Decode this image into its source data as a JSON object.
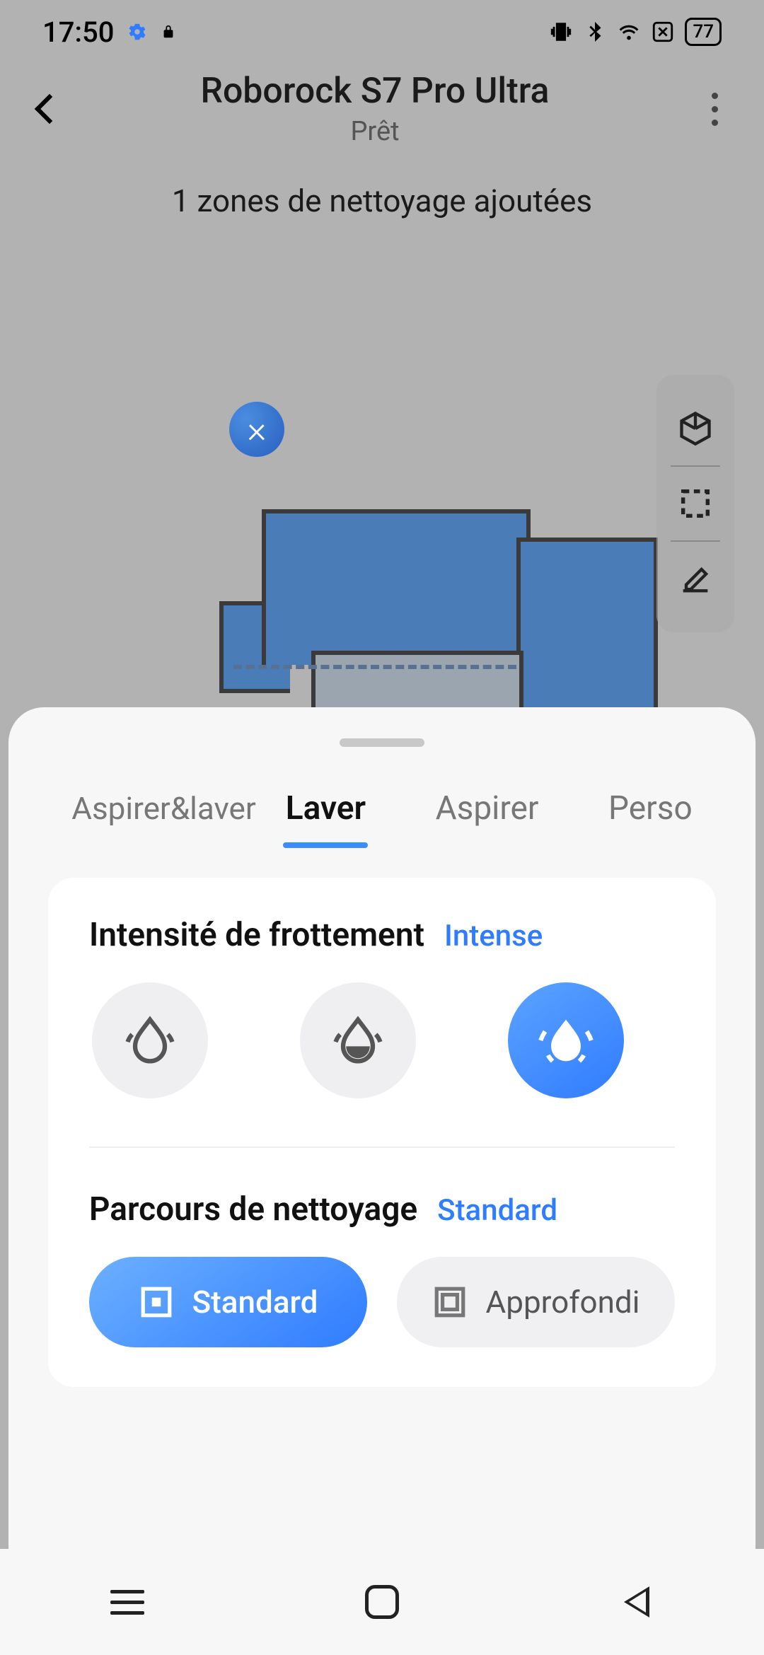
{
  "statusbar": {
    "time": "17:50",
    "battery": "77"
  },
  "header": {
    "title": "Roborock S7 Pro Ultra",
    "status": "Prêt"
  },
  "zones_message": "1 zones de nettoyage ajoutées",
  "sheet": {
    "tabs": [
      {
        "label": "Aspirer&laver",
        "active": false
      },
      {
        "label": "Laver",
        "active": true
      },
      {
        "label": "Aspirer",
        "active": false
      },
      {
        "label": "Perso",
        "active": false
      }
    ],
    "intensity": {
      "title": "Intensité de frottement",
      "value": "Intense",
      "options": [
        "low",
        "medium",
        "intense"
      ],
      "selected": "intense"
    },
    "route": {
      "title": "Parcours de nettoyage",
      "value": "Standard",
      "options": [
        {
          "label": "Standard",
          "selected": true
        },
        {
          "label": "Approfondi",
          "selected": false
        }
      ]
    }
  }
}
